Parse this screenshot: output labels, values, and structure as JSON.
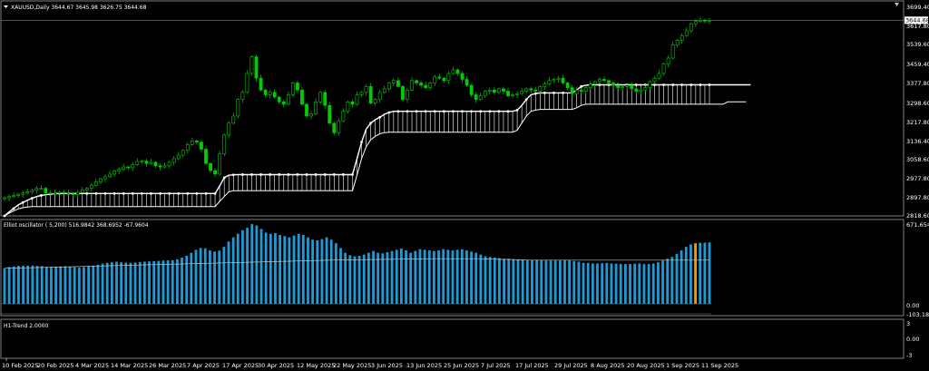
{
  "header": {
    "symbol_line": "XAUUSD,Daily  3644.67 3645.98 3626.75 3644.68"
  },
  "price_axis": {
    "labels": [
      "3699.40",
      "3617.80",
      "3539.60",
      "3459.40",
      "3377.80",
      "3298.60",
      "3217.80",
      "3136.40",
      "3058.60",
      "2977.80",
      "2897.80",
      "2818.60"
    ],
    "current_price": "3644.68"
  },
  "osc_panel": {
    "title": "Elliot oscillator ( 5,200) 516.9842 368.6952 -67.9604",
    "labels": [
      "671.6541",
      "0.00",
      "-103.1801"
    ]
  },
  "trend_panel": {
    "title": "H1-Trend 2.0000",
    "labels": [
      "3",
      "0.00",
      "-3"
    ]
  },
  "x_axis": {
    "labels": [
      "10 Feb 2025",
      "20 Feb 2025",
      "4 Mar 2025",
      "14 Mar 2025",
      "26 Mar 2025",
      "7 Apr 2025",
      "17 Apr 2025",
      "30 Apr 2025",
      "12 May 2025",
      "22 May 2025",
      "3 Jun 2025",
      "13 Jun 2025",
      "25 Jun 2025",
      "7 Jul 2025",
      "17 Jul 2025",
      "29 Jul 2025",
      "8 Aug 2025",
      "20 Aug 2025",
      "1 Sep 2025",
      "11 Sep 2025"
    ]
  },
  "colors": {
    "background": "#000000",
    "candle": "#00cc00",
    "cloud_line": "#ffffff",
    "osc_bar": "#1e9bd7",
    "osc_highlight": "#ff9900",
    "signal_line": "#c0c0c0",
    "grid": "#808080"
  },
  "chart_data": [
    {
      "type": "candlestick",
      "title": "XAUUSD,Daily",
      "ylim": [
        2818.6,
        3699.4
      ],
      "x_start": "10 Feb 2025",
      "x_end": "11 Sep 2025",
      "close": [
        2895,
        2900,
        2905,
        2910,
        2915,
        2920,
        2927,
        2935,
        2935,
        2915,
        2912,
        2916,
        2918,
        2915,
        2912,
        2908,
        2918,
        2928,
        2935,
        2948,
        2962,
        2975,
        2984,
        2995,
        3008,
        3015,
        3025,
        3022,
        3035,
        3048,
        3050,
        3040,
        3045,
        3030,
        3025,
        3030,
        3045,
        3060,
        3075,
        3095,
        3120,
        3135,
        3130,
        3100,
        3040,
        3010,
        2995,
        3080,
        3160,
        3210,
        3240,
        3310,
        3340,
        3420,
        3490,
        3400,
        3350,
        3330,
        3340,
        3320,
        3300,
        3290,
        3330,
        3380,
        3350,
        3290,
        3240,
        3250,
        3300,
        3340,
        3285,
        3210,
        3170,
        3220,
        3260,
        3300,
        3290,
        3330,
        3340,
        3365,
        3295,
        3310,
        3340,
        3355,
        3380,
        3390,
        3365,
        3310,
        3350,
        3390,
        3380,
        3370,
        3360,
        3380,
        3405,
        3400,
        3390,
        3420,
        3435,
        3420,
        3395,
        3370,
        3330,
        3310,
        3325,
        3345,
        3350,
        3340,
        3355,
        3345,
        3325,
        3330,
        3335,
        3345,
        3355,
        3350,
        3345,
        3365,
        3375,
        3390,
        3395,
        3400,
        3380,
        3360,
        3335,
        3350,
        3345,
        3360,
        3375,
        3385,
        3395,
        3390,
        3380,
        3370,
        3360,
        3365,
        3370,
        3355,
        3345,
        3350,
        3360,
        3385,
        3400,
        3420,
        3460,
        3485,
        3540,
        3560,
        3580,
        3600,
        3630,
        3640,
        3645,
        3642,
        3644.68
      ],
      "cloud_upper": [
        2818.6,
        2835,
        2850,
        2865,
        2875,
        2885,
        2893,
        2900,
        2905,
        2908,
        2910,
        2912,
        2913,
        2913,
        2913,
        2913,
        2913,
        2913,
        2913,
        2913,
        2913,
        2913,
        2913,
        2913,
        2913,
        2913,
        2913,
        2913,
        2913,
        2913,
        2913,
        2913,
        2913,
        2913,
        2913,
        2913,
        2913,
        2913,
        2913,
        2913,
        2913,
        2913,
        2913,
        2913,
        2913,
        2913,
        2913,
        2945,
        2980,
        2990,
        2992,
        2993,
        2993,
        2993,
        2993,
        2993,
        2993,
        2993,
        2993,
        2993,
        2993,
        2993,
        2993,
        2993,
        2993,
        2993,
        2993,
        2993,
        2993,
        2993,
        2993,
        2993,
        2993,
        2993,
        2993,
        2993,
        2993,
        3060,
        3130,
        3185,
        3210,
        3225,
        3235,
        3248,
        3255,
        3260,
        3260,
        3260,
        3260,
        3260,
        3260,
        3260,
        3260,
        3260,
        3260,
        3260,
        3260,
        3260,
        3260,
        3260,
        3260,
        3260,
        3260,
        3260,
        3260,
        3260,
        3260,
        3260,
        3260,
        3260,
        3260,
        3260,
        3265,
        3285,
        3310,
        3330,
        3335,
        3338,
        3338,
        3338,
        3338,
        3338,
        3338,
        3338,
        3338,
        3350,
        3365,
        3370,
        3372,
        3372,
        3372,
        3372,
        3372,
        3372,
        3372,
        3372,
        3372,
        3372,
        3372,
        3372,
        3372,
        3372,
        3372,
        3372,
        3372,
        3372,
        3372,
        3372,
        3372,
        3372,
        3372,
        3372,
        3372,
        3372,
        3372,
        3372,
        3372,
        3372,
        3372,
        3372,
        3372,
        3372,
        3372,
        3372
      ],
      "cloud_lower": [
        2818.6,
        2830,
        2840,
        2848,
        2853,
        2856,
        2858,
        2858,
        2858,
        2858,
        2858,
        2858,
        2858,
        2858,
        2858,
        2858,
        2858,
        2858,
        2858,
        2858,
        2858,
        2858,
        2858,
        2858,
        2858,
        2858,
        2858,
        2858,
        2858,
        2858,
        2858,
        2858,
        2858,
        2858,
        2858,
        2858,
        2858,
        2858,
        2858,
        2858,
        2858,
        2858,
        2858,
        2858,
        2858,
        2858,
        2858,
        2880,
        2900,
        2920,
        2925,
        2925,
        2925,
        2925,
        2925,
        2925,
        2925,
        2925,
        2925,
        2925,
        2925,
        2925,
        2925,
        2925,
        2925,
        2925,
        2925,
        2925,
        2925,
        2925,
        2925,
        2925,
        2925,
        2925,
        2925,
        2925,
        2925,
        2990,
        3060,
        3110,
        3140,
        3155,
        3165,
        3170,
        3172,
        3172,
        3172,
        3172,
        3172,
        3172,
        3172,
        3172,
        3172,
        3172,
        3172,
        3172,
        3172,
        3172,
        3172,
        3172,
        3172,
        3172,
        3172,
        3172,
        3172,
        3172,
        3172,
        3172,
        3172,
        3172,
        3172,
        3172,
        3180,
        3210,
        3240,
        3260,
        3265,
        3268,
        3268,
        3268,
        3268,
        3268,
        3268,
        3268,
        3268,
        3275,
        3285,
        3290,
        3290,
        3290,
        3290,
        3290,
        3290,
        3290,
        3290,
        3290,
        3290,
        3290,
        3290,
        3290,
        3290,
        3290,
        3290,
        3290,
        3290,
        3290,
        3290,
        3290,
        3290,
        3290,
        3290,
        3290,
        3290,
        3290,
        3290,
        3290,
        3290,
        3290,
        3300,
        3300,
        3300,
        3300,
        3300
      ]
    },
    {
      "type": "bar",
      "title": "Elliot oscillator ( 5,200) 516.9842 368.6952 -67.9604",
      "ylim": [
        -103.1801,
        671.6541
      ],
      "values": [
        300,
        310,
        315,
        320,
        320,
        322,
        322,
        320,
        318,
        312,
        310,
        312,
        315,
        318,
        312,
        308,
        305,
        310,
        315,
        322,
        330,
        338,
        345,
        350,
        355,
        350,
        348,
        345,
        348,
        352,
        355,
        358,
        360,
        362,
        365,
        367,
        368,
        375,
        390,
        405,
        430,
        455,
        470,
        468,
        450,
        440,
        448,
        480,
        525,
        560,
        590,
        620,
        640,
        671,
        660,
        630,
        600,
        590,
        595,
        580,
        570,
        560,
        575,
        590,
        580,
        560,
        540,
        535,
        545,
        560,
        540,
        510,
        470,
        430,
        410,
        400,
        405,
        415,
        430,
        445,
        430,
        425,
        435,
        445,
        455,
        465,
        450,
        430,
        445,
        460,
        455,
        450,
        445,
        450,
        460,
        455,
        450,
        455,
        460,
        450,
        440,
        430,
        415,
        400,
        395,
        390,
        385,
        380,
        380,
        378,
        375,
        372,
        370,
        370,
        372,
        370,
        365,
        365,
        365,
        365,
        368,
        370,
        360,
        355,
        345,
        345,
        340,
        340,
        342,
        345,
        340,
        338,
        335,
        335,
        335,
        338,
        340,
        335,
        335,
        340,
        350,
        365,
        380,
        395,
        420,
        450,
        480,
        500,
        510,
        515,
        515,
        516.98
      ],
      "signal": [
        300,
        301,
        302,
        302,
        303,
        304,
        304,
        305,
        306,
        307,
        308,
        309,
        310,
        311,
        312,
        313,
        314,
        315,
        316,
        317,
        318,
        319,
        320,
        321,
        322,
        323,
        324,
        325,
        326,
        327,
        328,
        329,
        330,
        331,
        332,
        333,
        334,
        335,
        336,
        337,
        338,
        339,
        340,
        341,
        342,
        343,
        344,
        345,
        346,
        347,
        348,
        349,
        350,
        351,
        352,
        353,
        354,
        355,
        356,
        357,
        358,
        359,
        360,
        361,
        362,
        363,
        364,
        365,
        366,
        367,
        368,
        369,
        370,
        370,
        371,
        371,
        372,
        372,
        373,
        373,
        374,
        374,
        375,
        375,
        376,
        376,
        377,
        377,
        378,
        378,
        379,
        379,
        380,
        380,
        380,
        380,
        380,
        380,
        380,
        380,
        380,
        380,
        379,
        378,
        377,
        376,
        375,
        374,
        373,
        372,
        371,
        370,
        369,
        368,
        368,
        368,
        368,
        368,
        368,
        368,
        368,
        368,
        368,
        368,
        368,
        368,
        368,
        368,
        368,
        368,
        368,
        368,
        368,
        368,
        368,
        368,
        368,
        368,
        368,
        368,
        368,
        368,
        368,
        368,
        368,
        368,
        368,
        368,
        368,
        368,
        368,
        368.7
      ],
      "highlight_index": 148
    },
    {
      "type": "line",
      "title": "H1-Trend 2.0000",
      "ylim": [
        -3,
        3
      ],
      "values": []
    }
  ]
}
